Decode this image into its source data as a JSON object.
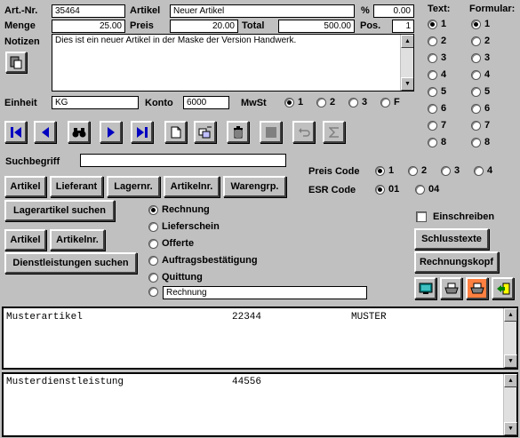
{
  "artikel": {
    "artnr_label": "Art.-Nr.",
    "artnr_value": "35464",
    "artikel_label": "Artikel",
    "artikel_value": "Neuer Artikel",
    "percent_label": "%",
    "percent_value": "0.00",
    "menge_label": "Menge",
    "menge_value": "25.00",
    "preis_label": "Preis",
    "preis_value": "20.00",
    "total_label": "Total",
    "total_value": "500.00",
    "pos_label": "Pos.",
    "pos_value": "1",
    "notizen_label": "Notizen",
    "notizen_value": "Dies ist ein neuer Artikel in der Maske der Version Handwerk.",
    "einheit_label": "Einheit",
    "einheit_value": "KG",
    "konto_label": "Konto",
    "konto_value": "6000",
    "mwst_label": "MwSt",
    "mwst_options": [
      "1",
      "2",
      "3",
      "F"
    ],
    "mwst_selected": "1"
  },
  "text_col": {
    "label": "Text:",
    "options": [
      "1",
      "2",
      "3",
      "4",
      "5",
      "6",
      "7",
      "8"
    ],
    "selected": "1"
  },
  "formular_col": {
    "label": "Formular:",
    "options": [
      "1",
      "2",
      "3",
      "4",
      "5",
      "6",
      "7",
      "8"
    ],
    "selected": "1"
  },
  "toolbar": {
    "icons": [
      "first-icon",
      "prev-icon",
      "binoculars-icon",
      "next-icon",
      "last-icon",
      "new-document-icon",
      "edit-icon",
      "trash-icon",
      "stop-icon",
      "undo-icon",
      "sum-icon"
    ]
  },
  "search": {
    "label": "Suchbegriff",
    "value": ""
  },
  "sort_buttons": [
    "Artikel",
    "Lieferant",
    "Lagernr.",
    "Artikelnr.",
    "Warengrp."
  ],
  "lagerartikel_button": "Lagerartikel suchen",
  "sort_buttons2": [
    "Artikel",
    "Artikelnr."
  ],
  "dienstleistungen_button": "Dienstleistungen suchen",
  "preis_code": {
    "label": "Preis Code",
    "options": [
      "1",
      "2",
      "3",
      "4"
    ],
    "selected": "1"
  },
  "esr_code": {
    "label": "ESR Code",
    "options": [
      "01",
      "04"
    ],
    "selected": "01"
  },
  "doc_type": {
    "options": [
      "Rechnung",
      "Lieferschein",
      "Offerte",
      "Auftragsbestätigung",
      "Quittung"
    ],
    "selected": "Rechnung",
    "custom_value": "Rechnung"
  },
  "einschreiben_label": "Einschreiben",
  "schlusstexte_button": "Schlusstexte",
  "rechnungskopf_button": "Rechnungskopf",
  "action_icons": [
    "screen-icon",
    "printer-icon",
    "print-color-icon",
    "exit-icon"
  ],
  "list1": {
    "rows": [
      {
        "name": "Musterartikel",
        "nr": "22344",
        "lieferant": "MUSTER"
      }
    ]
  },
  "list2": {
    "rows": [
      {
        "name": "Musterdienstleistung",
        "nr": "44556"
      }
    ]
  },
  "colors": {
    "toolbar_blue": "#0000c0",
    "window_bg": "#c0c0c0",
    "print_highlight": "#ff8040"
  }
}
